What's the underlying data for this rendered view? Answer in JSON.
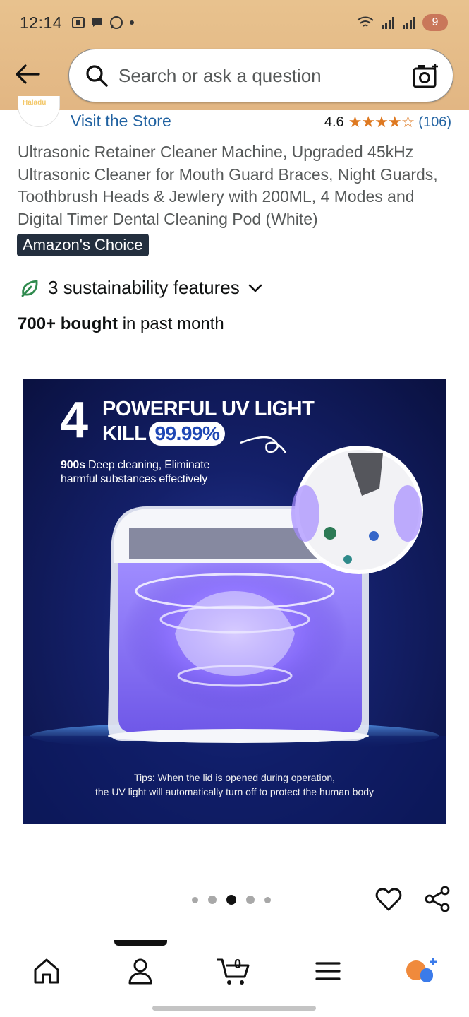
{
  "status_bar": {
    "time": "12:14",
    "battery": "9"
  },
  "search": {
    "placeholder": "Search or ask a question"
  },
  "store": {
    "logo_text": "Haladu",
    "visit_label": "Visit the Store",
    "rating": "4.6",
    "stars": "★★★★☆",
    "review_count": "(106)"
  },
  "product": {
    "title": "Ultrasonic Retainer Cleaner Machine, Upgraded 45kHz Ultrasonic Cleaner for Mouth Guard Braces, Night Guards, Toothbrush Heads & Jewlery with 200ML, 4 Modes and Digital Timer Dental Cleaning Pod (White)",
    "badge": "Amazon's Choice",
    "sustainability": "3 sustainability features",
    "bought_bold": "700+ bought",
    "bought_rest": " in past month"
  },
  "image": {
    "big_number": "4",
    "headline_1": "POWERFUL UV LIGHT",
    "headline_2": "KILL",
    "kill_pct": "99.99%",
    "desc_bold": "900s",
    "desc_1": " Deep cleaning, Eliminate",
    "desc_2": "harmful substances effectively",
    "tips_1": "Tips: When the lid is opened during operation,",
    "tips_2": "the UV light will automatically turn off to protect the human body"
  },
  "carousel": {
    "count": 5,
    "active_index": 2
  },
  "bottom_nav": {
    "cart_count": "0"
  },
  "colors": {
    "header_bg": "#e2b683",
    "link": "#2162a1",
    "star": "#de7921",
    "badge_bg": "#232f3e",
    "leaf": "#2f8a4e",
    "ai_orange": "#f08a3c",
    "ai_blue": "#3b7bea"
  },
  "icons": [
    "back-arrow-icon",
    "search-icon",
    "camera-icon",
    "leaf-icon",
    "chevron-down-icon",
    "heart-icon",
    "share-icon",
    "home-icon",
    "account-icon",
    "cart-icon",
    "menu-icon",
    "rufus-ai-icon"
  ]
}
